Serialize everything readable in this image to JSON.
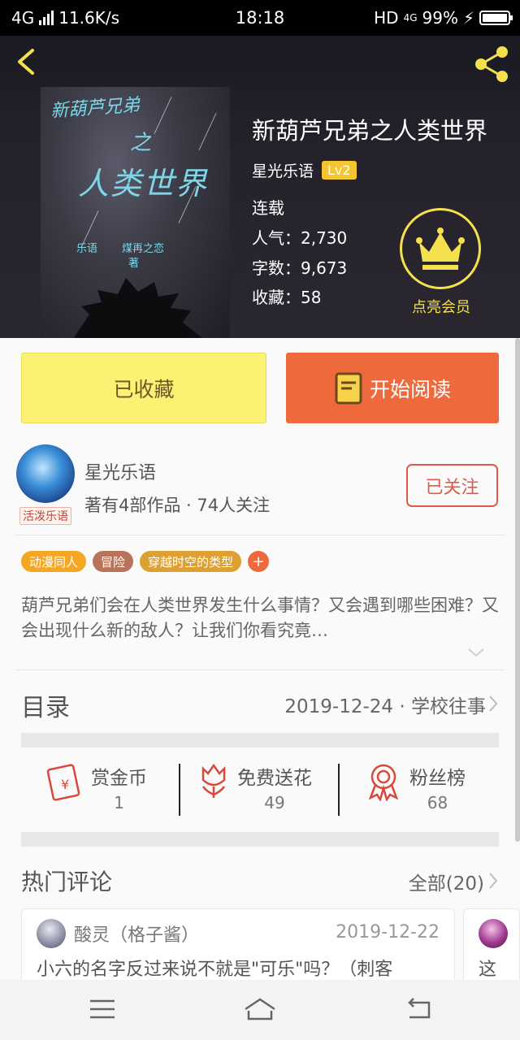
{
  "status_bar": {
    "network": "4G",
    "speed": "11.6K/s",
    "time": "18:18",
    "hd_label": "HD",
    "hd_network": "4G",
    "battery": "99%",
    "battery_level": 0.99
  },
  "book": {
    "title": "新葫芦兄弟之人类世界",
    "author": "星光乐语",
    "level": "Lv2",
    "status": "连载",
    "popularity": "人气：2,730",
    "word_count": "字数：9,673",
    "favorites": "收藏：58",
    "vip_label": "点亮会员",
    "cover": {
      "line1": "新葫芦兄弟",
      "line2": "之",
      "line3": "人类世界",
      "author1": "乐语",
      "author2": "煤再之恋",
      "author3": "著"
    }
  },
  "actions": {
    "collected_label": "已收藏",
    "read_label": "开始阅读"
  },
  "author_block": {
    "name": "星光乐语",
    "info": "著有4部作品 · 74人关注",
    "avatar_tag": "活泼乐语",
    "follow_label": "已关注"
  },
  "tags": [
    {
      "label": "动漫同人",
      "color": "#f5a623"
    },
    {
      "label": "冒险",
      "color": "#b9735a"
    },
    {
      "label": "穿越时空的类型",
      "color": "#dda033"
    }
  ],
  "tag_add": "+",
  "description": "葫芦兄弟们会在人类世界发生什么事情？又会遇到哪些困难？又会出现什么新的敌人？让我们你看究竟…",
  "toc": {
    "title": "目录",
    "latest": "2019-12-24 · 学校往事"
  },
  "stats": [
    {
      "label": "赏金币",
      "value": "1",
      "icon": "red-envelope-icon"
    },
    {
      "label": "免费送花",
      "value": "49",
      "icon": "flower-icon"
    },
    {
      "label": "粉丝榜",
      "value": "68",
      "icon": "medal-icon"
    }
  ],
  "comments": {
    "title": "热门评论",
    "all_label": "全部(20)",
    "items": [
      {
        "user": "酸灵（格子酱）",
        "date": "2019-12-22",
        "text": "小六的名字反过来说不就是\"可乐\"吗？（刺客"
      },
      {
        "text": "这"
      }
    ]
  },
  "colors": {
    "accent_orange": "#ee6a3d",
    "collected_yellow": "#fbf173",
    "vip_gold": "#f5e04d",
    "follow_red": "#e0594a"
  }
}
